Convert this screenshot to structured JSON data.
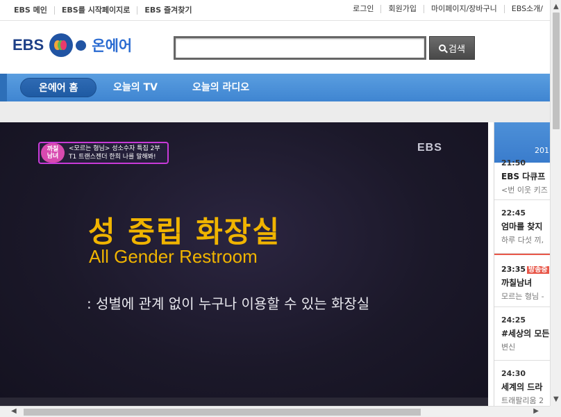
{
  "topbar": {
    "left_links": [
      "EBS 메인",
      "EBS를 시작페이지로",
      "EBS 즐겨찾기"
    ],
    "right_links": [
      "로그인",
      "회원가입",
      "마이페이지/장바구니",
      "EBS소개/"
    ]
  },
  "header": {
    "logo_text": "EBS",
    "service_name": "온에어",
    "search_placeholder": "",
    "search_button": "검색"
  },
  "nav": {
    "tabs": [
      "온에어 홈",
      "오늘의 TV",
      "오늘의 라디오"
    ],
    "active": 0
  },
  "video": {
    "show_badge": "까칠\n남녀",
    "badge_line1": "<모르는 형님> 성소수자 특집 2부",
    "badge_line2": "T1 트랜스젠더 한희 나를 말해봐!",
    "watermark": "EBS",
    "title_ko": "성 중립 화장실",
    "title_en": "All Gender Restroom",
    "subtitle": ": 성별에 관계 없이 누구나 이용할 수 있는 화장실"
  },
  "schedule": {
    "date": "201",
    "items": [
      {
        "time": "21:50",
        "title": "EBS 다큐프",
        "desc": "<번 이웃 키즈"
      },
      {
        "time": "22:45",
        "title": "엄마를 찾지",
        "desc": "하루 다섯 끼,"
      },
      {
        "time": "23:35",
        "live": "방송중",
        "title": "까칠남녀",
        "desc": "모르는 형님 -"
      },
      {
        "time": "24:25",
        "title": "#세상의 모든",
        "desc": "변신"
      },
      {
        "time": "24:30",
        "title": "세계의 드라",
        "desc": "트래팔리움 2"
      }
    ]
  },
  "scroll": {
    "up": "▲",
    "down": "▼",
    "left": "◀",
    "right": "▶"
  }
}
